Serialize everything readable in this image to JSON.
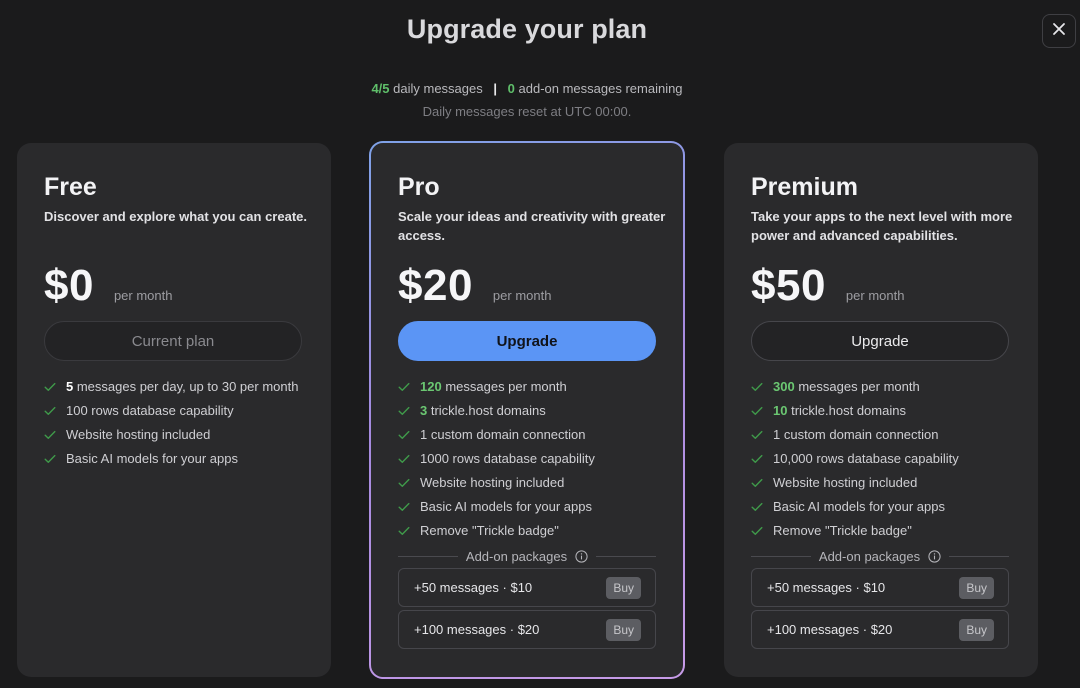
{
  "modal": {
    "title": "Upgrade your plan",
    "close_icon": "close-icon"
  },
  "usage": {
    "daily_count": "4/5",
    "daily_label": "daily messages",
    "separator": "|",
    "addon_count": "0",
    "addon_label": "add-on messages remaining",
    "reset_note": "Daily messages reset at UTC 00:00."
  },
  "colors": {
    "accent_blue": "#5b95f5",
    "highlight_green": "#6bc772",
    "card_bg": "#2a2a2c",
    "page_bg": "#1b1b1c"
  },
  "plans": {
    "free": {
      "name": "Free",
      "description": "Discover and explore what you can create.",
      "price": "$0",
      "per": "per month",
      "button": "Current plan",
      "features": [
        {
          "hl": "5",
          "text": " messages per day, up to 30 per month"
        },
        {
          "hl": "",
          "text": "100 rows database capability"
        },
        {
          "hl": "",
          "text": "Website hosting included"
        },
        {
          "hl": "",
          "text": "Basic AI models for your apps"
        }
      ]
    },
    "pro": {
      "name": "Pro",
      "description": "Scale your ideas and creativity with greater access.",
      "price": "$20",
      "per": "per month",
      "button": "Upgrade",
      "features": [
        {
          "hl": "120",
          "text": " messages per month"
        },
        {
          "hl": "3",
          "text": " trickle.host domains"
        },
        {
          "hl": "",
          "text": "1 custom domain connection"
        },
        {
          "hl": "",
          "text": "1000 rows database capability"
        },
        {
          "hl": "",
          "text": "Website hosting included"
        },
        {
          "hl": "",
          "text": "Basic AI models for your apps"
        },
        {
          "hl": "",
          "text": "Remove \"Trickle badge\""
        }
      ],
      "addon_header": "Add-on packages",
      "addons": [
        {
          "label": "+50 messages · $10",
          "buy": "Buy"
        },
        {
          "label": "+100 messages · $20",
          "buy": "Buy"
        }
      ]
    },
    "premium": {
      "name": "Premium",
      "description": "Take your apps to the next level with more power and advanced capabilities.",
      "price": "$50",
      "per": "per month",
      "button": "Upgrade",
      "features": [
        {
          "hl": "300",
          "text": " messages per month"
        },
        {
          "hl": "10",
          "text": " trickle.host domains"
        },
        {
          "hl": "",
          "text": "1 custom domain connection"
        },
        {
          "hl": "",
          "text": "10,000 rows database capability"
        },
        {
          "hl": "",
          "text": "Website hosting included"
        },
        {
          "hl": "",
          "text": "Basic AI models for your apps"
        },
        {
          "hl": "",
          "text": "Remove \"Trickle badge\""
        }
      ],
      "addon_header": "Add-on packages",
      "addons": [
        {
          "label": "+50 messages · $10",
          "buy": "Buy"
        },
        {
          "label": "+100 messages · $20",
          "buy": "Buy"
        }
      ]
    }
  }
}
